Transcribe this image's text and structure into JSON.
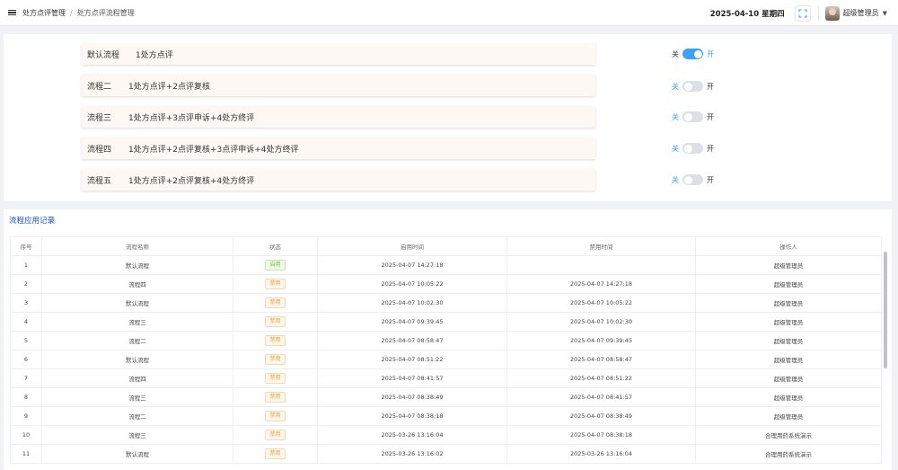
{
  "header": {
    "breadcrumb": [
      "处方点评管理",
      "处方点评流程管理"
    ],
    "date": "2025-04-10 星期四",
    "user": "超级管理员"
  },
  "flows": [
    {
      "name": "默认流程",
      "desc": "1处方点评",
      "off_label": "关",
      "on_label": "开",
      "enabled": true
    },
    {
      "name": "流程二",
      "desc": "1处方点评+2点评复核",
      "off_label": "关",
      "on_label": "开",
      "enabled": false
    },
    {
      "name": "流程三",
      "desc": "1处方点评+3点评申诉+4处方终评",
      "off_label": "关",
      "on_label": "开",
      "enabled": false
    },
    {
      "name": "流程四",
      "desc": "1处方点评+2点评复核+3点评申诉+4处方终评",
      "off_label": "关",
      "on_label": "开",
      "enabled": false
    },
    {
      "name": "流程五",
      "desc": "1处方点评+2点评复核+4处方终评",
      "off_label": "关",
      "on_label": "开",
      "enabled": false
    }
  ],
  "records": {
    "title": "流程应用记录",
    "columns": [
      "序号",
      "流程名称",
      "状态",
      "启用时间",
      "禁用时间",
      "操作人"
    ],
    "rows": [
      [
        "1",
        "默认流程",
        "启用",
        "2025-04-07 14:27:18",
        "",
        "超级管理员"
      ],
      [
        "2",
        "流程四",
        "禁用",
        "2025-04-07 10:05:22",
        "2025-04-07 14:27:18",
        "超级管理员"
      ],
      [
        "3",
        "默认流程",
        "禁用",
        "2025-04-07 10:02:30",
        "2025-04-07 10:05:22",
        "超级管理员"
      ],
      [
        "4",
        "流程三",
        "禁用",
        "2025-04-07 09:39:45",
        "2025-04-07 10:02:30",
        "超级管理员"
      ],
      [
        "5",
        "流程二",
        "禁用",
        "2025-04-07 08:58:47",
        "2025-04-07 09:39:45",
        "超级管理员"
      ],
      [
        "6",
        "默认流程",
        "禁用",
        "2025-04-07 08:51:22",
        "2025-04-07 08:58:47",
        "超级管理员"
      ],
      [
        "7",
        "流程四",
        "禁用",
        "2025-04-07 08:41:57",
        "2025-04-07 08:51:22",
        "超级管理员"
      ],
      [
        "8",
        "流程三",
        "禁用",
        "2025-04-07 08:38:49",
        "2025-04-07 08:41:57",
        "超级管理员"
      ],
      [
        "9",
        "流程二",
        "禁用",
        "2025-04-07 08:38:18",
        "2025-04-07 08:38:49",
        "超级管理员"
      ],
      [
        "10",
        "流程三",
        "禁用",
        "2025-03-26 13:16:04",
        "2025-04-07 08:38:18",
        "合理用药系统演示"
      ],
      [
        "11",
        "默认流程",
        "禁用",
        "2025-03-26 13:16:02",
        "2025-03-26 13:16:04",
        "合理用药系统演示"
      ]
    ]
  },
  "colors": {
    "accent": "#409eff",
    "enabled_tag": "#67c23a",
    "disabled_tag": "#e6a23c",
    "title": "#1a4fd6"
  }
}
